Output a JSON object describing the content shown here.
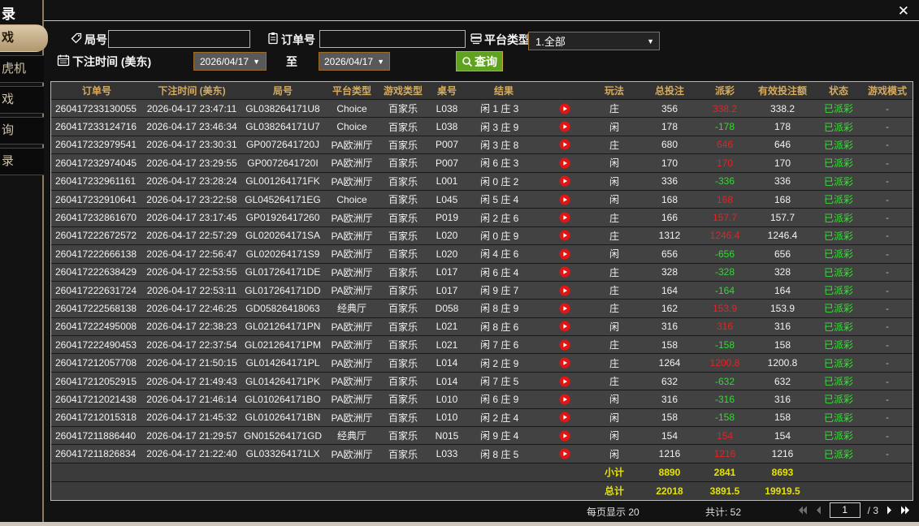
{
  "window": {
    "title_fragment": "录",
    "close_label": "✕"
  },
  "sidebar": {
    "tabs": [
      {
        "label": "戏",
        "active": true
      },
      {
        "label": "虎机",
        "active": false
      },
      {
        "label": "戏",
        "active": false
      },
      {
        "label": "询",
        "active": false
      },
      {
        "label": "录",
        "active": false
      }
    ]
  },
  "filters": {
    "round_label": "局号",
    "order_label": "订单号",
    "platform_label": "平台类型",
    "platform_value": "1.全部",
    "bet_time_label": "下注时间 (美东)",
    "date_from": "2026/04/17",
    "to_label": "至",
    "date_to": "2026/04/17",
    "search_label": "查询"
  },
  "colors": {
    "header_gold": "#d4ab61",
    "win_red": "#e32424",
    "loss_green": "#35d835",
    "status_green": "#3ae03a",
    "total_yellow": "#e6e300",
    "button_green": "#5ea21d",
    "border_orange": "#9c6b26",
    "tab_active_tan": "#c7ae89"
  },
  "table": {
    "headers": [
      "订单号",
      "下注时间 (美东)",
      "局号",
      "平台类型",
      "游戏类型",
      "桌号",
      "结果",
      "",
      "玩法",
      "总投注",
      "派彩",
      "有效投注额",
      "状态",
      "游戏模式"
    ],
    "rows": [
      {
        "order_no": "260417233130055",
        "time": "2026-04-17 23:47:11",
        "round": "GL038264171U8",
        "platform": "Choice",
        "game": "百家乐",
        "table_no": "L038",
        "result": "闲 1 庄 3",
        "play": "庄",
        "total": "356",
        "payout": "338.2",
        "payout_kind": "win",
        "valid": "338.2",
        "status": "已派彩",
        "mode": "-"
      },
      {
        "order_no": "260417233124716",
        "time": "2026-04-17 23:46:34",
        "round": "GL038264171U7",
        "platform": "Choice",
        "game": "百家乐",
        "table_no": "L038",
        "result": "闲 3 庄 9",
        "play": "闲",
        "total": "178",
        "payout": "-178",
        "payout_kind": "loss",
        "valid": "178",
        "status": "已派彩",
        "mode": "-"
      },
      {
        "order_no": "260417232979541",
        "time": "2026-04-17 23:30:31",
        "round": "GP0072641720J",
        "platform": "PA欧洲厅",
        "game": "百家乐",
        "table_no": "P007",
        "result": "闲 3 庄 8",
        "play": "庄",
        "total": "680",
        "payout": "646",
        "payout_kind": "win",
        "valid": "646",
        "status": "已派彩",
        "mode": "-"
      },
      {
        "order_no": "260417232974045",
        "time": "2026-04-17 23:29:55",
        "round": "GP0072641720I",
        "platform": "PA欧洲厅",
        "game": "百家乐",
        "table_no": "P007",
        "result": "闲 6 庄 3",
        "play": "闲",
        "total": "170",
        "payout": "170",
        "payout_kind": "win",
        "valid": "170",
        "status": "已派彩",
        "mode": "-"
      },
      {
        "order_no": "260417232961161",
        "time": "2026-04-17 23:28:24",
        "round": "GL001264171FK",
        "platform": "PA欧洲厅",
        "game": "百家乐",
        "table_no": "L001",
        "result": "闲 0 庄 2",
        "play": "闲",
        "total": "336",
        "payout": "-336",
        "payout_kind": "loss",
        "valid": "336",
        "status": "已派彩",
        "mode": "-"
      },
      {
        "order_no": "260417232910641",
        "time": "2026-04-17 23:22:58",
        "round": "GL045264171EG",
        "platform": "Choice",
        "game": "百家乐",
        "table_no": "L045",
        "result": "闲 5 庄 4",
        "play": "闲",
        "total": "168",
        "payout": "168",
        "payout_kind": "win",
        "valid": "168",
        "status": "已派彩",
        "mode": "-"
      },
      {
        "order_no": "260417232861670",
        "time": "2026-04-17 23:17:45",
        "round": "GP01926417260",
        "platform": "PA欧洲厅",
        "game": "百家乐",
        "table_no": "P019",
        "result": "闲 2 庄 6",
        "play": "庄",
        "total": "166",
        "payout": "157.7",
        "payout_kind": "win",
        "valid": "157.7",
        "status": "已派彩",
        "mode": "-"
      },
      {
        "order_no": "260417222672572",
        "time": "2026-04-17 22:57:29",
        "round": "GL020264171SA",
        "platform": "PA欧洲厅",
        "game": "百家乐",
        "table_no": "L020",
        "result": "闲 0 庄 9",
        "play": "庄",
        "total": "1312",
        "payout": "1246.4",
        "payout_kind": "win",
        "valid": "1246.4",
        "status": "已派彩",
        "mode": "-"
      },
      {
        "order_no": "260417222666138",
        "time": "2026-04-17 22:56:47",
        "round": "GL020264171S9",
        "platform": "PA欧洲厅",
        "game": "百家乐",
        "table_no": "L020",
        "result": "闲 4 庄 6",
        "play": "闲",
        "total": "656",
        "payout": "-656",
        "payout_kind": "loss",
        "valid": "656",
        "status": "已派彩",
        "mode": "-"
      },
      {
        "order_no": "260417222638429",
        "time": "2026-04-17 22:53:55",
        "round": "GL017264171DE",
        "platform": "PA欧洲厅",
        "game": "百家乐",
        "table_no": "L017",
        "result": "闲 6 庄 4",
        "play": "庄",
        "total": "328",
        "payout": "-328",
        "payout_kind": "loss",
        "valid": "328",
        "status": "已派彩",
        "mode": "-"
      },
      {
        "order_no": "260417222631724",
        "time": "2026-04-17 22:53:11",
        "round": "GL017264171DD",
        "platform": "PA欧洲厅",
        "game": "百家乐",
        "table_no": "L017",
        "result": "闲 9 庄 7",
        "play": "庄",
        "total": "164",
        "payout": "-164",
        "payout_kind": "loss",
        "valid": "164",
        "status": "已派彩",
        "mode": "-"
      },
      {
        "order_no": "260417222568138",
        "time": "2026-04-17 22:46:25",
        "round": "GD05826418063",
        "platform": "经典厅",
        "game": "百家乐",
        "table_no": "D058",
        "result": "闲 8 庄 9",
        "play": "庄",
        "total": "162",
        "payout": "153.9",
        "payout_kind": "win",
        "valid": "153.9",
        "status": "已派彩",
        "mode": "-"
      },
      {
        "order_no": "260417222495008",
        "time": "2026-04-17 22:38:23",
        "round": "GL021264171PN",
        "platform": "PA欧洲厅",
        "game": "百家乐",
        "table_no": "L021",
        "result": "闲 8 庄 6",
        "play": "闲",
        "total": "316",
        "payout": "316",
        "payout_kind": "win",
        "valid": "316",
        "status": "已派彩",
        "mode": "-"
      },
      {
        "order_no": "260417222490453",
        "time": "2026-04-17 22:37:54",
        "round": "GL021264171PM",
        "platform": "PA欧洲厅",
        "game": "百家乐",
        "table_no": "L021",
        "result": "闲 7 庄 6",
        "play": "庄",
        "total": "158",
        "payout": "-158",
        "payout_kind": "loss",
        "valid": "158",
        "status": "已派彩",
        "mode": "-"
      },
      {
        "order_no": "260417212057708",
        "time": "2026-04-17 21:50:15",
        "round": "GL014264171PL",
        "platform": "PA欧洲厅",
        "game": "百家乐",
        "table_no": "L014",
        "result": "闲 2 庄 9",
        "play": "庄",
        "total": "1264",
        "payout": "1200.8",
        "payout_kind": "win",
        "valid": "1200.8",
        "status": "已派彩",
        "mode": "-"
      },
      {
        "order_no": "260417212052915",
        "time": "2026-04-17 21:49:43",
        "round": "GL014264171PK",
        "platform": "PA欧洲厅",
        "game": "百家乐",
        "table_no": "L014",
        "result": "闲 7 庄 5",
        "play": "庄",
        "total": "632",
        "payout": "-632",
        "payout_kind": "loss",
        "valid": "632",
        "status": "已派彩",
        "mode": "-"
      },
      {
        "order_no": "260417212021438",
        "time": "2026-04-17 21:46:14",
        "round": "GL010264171BO",
        "platform": "PA欧洲厅",
        "game": "百家乐",
        "table_no": "L010",
        "result": "闲 6 庄 9",
        "play": "闲",
        "total": "316",
        "payout": "-316",
        "payout_kind": "loss",
        "valid": "316",
        "status": "已派彩",
        "mode": "-"
      },
      {
        "order_no": "260417212015318",
        "time": "2026-04-17 21:45:32",
        "round": "GL010264171BN",
        "platform": "PA欧洲厅",
        "game": "百家乐",
        "table_no": "L010",
        "result": "闲 2 庄 4",
        "play": "闲",
        "total": "158",
        "payout": "-158",
        "payout_kind": "loss",
        "valid": "158",
        "status": "已派彩",
        "mode": "-"
      },
      {
        "order_no": "260417211886440",
        "time": "2026-04-17 21:29:57",
        "round": "GN015264171GD",
        "platform": "经典厅",
        "game": "百家乐",
        "table_no": "N015",
        "result": "闲 9 庄 4",
        "play": "闲",
        "total": "154",
        "payout": "154",
        "payout_kind": "win",
        "valid": "154",
        "status": "已派彩",
        "mode": "-"
      },
      {
        "order_no": "260417211826834",
        "time": "2026-04-17 21:22:40",
        "round": "GL033264171LX",
        "platform": "PA欧洲厅",
        "game": "百家乐",
        "table_no": "L033",
        "result": "闲 8 庄 5",
        "play": "闲",
        "total": "1216",
        "payout": "1216",
        "payout_kind": "win",
        "valid": "1216",
        "status": "已派彩",
        "mode": "-"
      }
    ],
    "subtotal": {
      "label": "小计",
      "total": "8890",
      "payout": "2841",
      "valid": "8693"
    },
    "grand_total": {
      "label": "总计",
      "total": "22018",
      "payout": "3891.5",
      "valid": "19919.5"
    }
  },
  "pagination": {
    "per_page_label": "每页显示 20",
    "total_label": "共计: 52",
    "page": "1",
    "of_pages": "/  3"
  }
}
